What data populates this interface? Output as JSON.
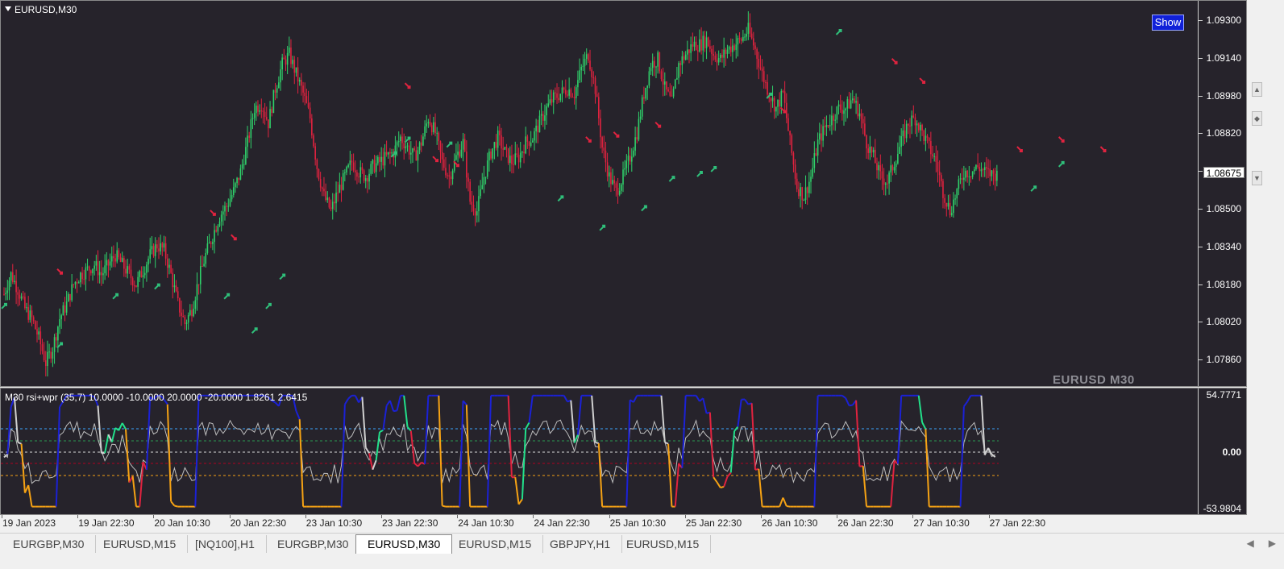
{
  "window": {
    "title": "EURUSD,M30"
  },
  "main_chart": {
    "symbol_title": "EURUSD,M30",
    "show_button": "Show",
    "watermark": "EURUSD M30",
    "current_price": "1.08675",
    "price_ticks": [
      "1.09300",
      "1.09140",
      "1.08980",
      "1.08820",
      "1.08660",
      "1.08500",
      "1.08340",
      "1.08180",
      "1.08020",
      "1.07860"
    ],
    "colors": {
      "background": "#26232b",
      "bull": "#2fd06a",
      "bear": "#e0233f",
      "buy_arrow": "#2fbf7a",
      "sell_arrow": "#e0233f"
    }
  },
  "indicator": {
    "title": "M30 rsi+wpr (35,7) 10.0000 -10.0000 20.0000 -20.0000 1.8261 2.6415",
    "ticks": [
      "54.7771",
      "0.00",
      "-53.9804"
    ],
    "colors": {
      "high": "#1b21d6",
      "upper": "#22e08a",
      "neutral": "#d0d0d0",
      "lower": "#e0233f",
      "low": "#f5a214"
    }
  },
  "time_axis": {
    "labels": [
      "19 Jan 2023",
      "19 Jan 22:30",
      "20 Jan 10:30",
      "20 Jan 22:30",
      "23 Jan 10:30",
      "23 Jan 22:30",
      "24 Jan 10:30",
      "24 Jan 22:30",
      "25 Jan 10:30",
      "25 Jan 22:30",
      "26 Jan 10:30",
      "26 Jan 22:30",
      "27 Jan 10:30",
      "27 Jan 22:30"
    ]
  },
  "tabs": [
    {
      "label": "EURGBP,M30",
      "active": false
    },
    {
      "label": "EURUSD,M15",
      "active": false
    },
    {
      "label": "[NQ100],H1",
      "active": false
    },
    {
      "label": "EURGBP,M30",
      "active": false
    },
    {
      "label": "EURUSD,M30",
      "active": true
    },
    {
      "label": "EURUSD,M15",
      "active": false
    },
    {
      "label": "GBPJPY,H1",
      "active": false
    },
    {
      "label": "EURUSD,M15",
      "active": false
    }
  ],
  "price_path": [
    [
      1.0818,
      1.0826,
      1.082,
      1.0812,
      1.0808,
      1.08,
      1.079,
      1.0796,
      1.0808,
      1.0814,
      1.0822,
      1.0826,
      1.0828,
      1.083,
      1.0826,
      1.083,
      1.0834,
      1.083,
      1.0826,
      1.0822,
      1.0828,
      1.0834,
      1.0838,
      1.0836,
      1.0826,
      1.0814,
      1.0806,
      1.0812,
      1.0824,
      1.0834,
      1.0842,
      1.085,
      1.0854,
      1.086,
      1.0868,
      1.088,
      1.0894,
      1.0896,
      1.0888,
      1.0902,
      1.0912,
      1.0916,
      1.0908,
      1.09,
      1.089,
      1.087,
      1.0858,
      1.0852,
      1.086,
      1.0866,
      1.0872,
      1.0868,
      1.0866,
      1.087,
      1.0872,
      1.0874,
      1.0876,
      1.0882,
      1.0878,
      1.0874,
      1.088,
      1.089,
      1.0884,
      1.0872,
      1.0866,
      1.0874,
      1.088,
      1.0856,
      1.0852,
      1.0866,
      1.0876,
      1.0882,
      1.0876,
      1.0872,
      1.0874,
      1.088,
      1.0882,
      1.0888,
      1.0894,
      1.0898,
      1.09,
      1.0902,
      1.09,
      1.091,
      1.0916,
      1.0902,
      1.0878,
      1.0866,
      1.086,
      1.0866,
      1.0874,
      1.0884,
      1.09,
      1.0912,
      1.0914,
      1.0902,
      1.0896,
      1.0912,
      1.0916,
      1.092,
      1.092,
      1.0922,
      1.0916,
      1.0914,
      1.0918,
      1.092,
      1.0922,
      1.0926,
      1.0918,
      1.0908,
      1.09,
      1.0894,
      1.09,
      1.088,
      1.0862,
      1.0858,
      1.0866,
      1.088,
      1.0886,
      1.089,
      1.0894,
      1.0894,
      1.0898,
      1.0892,
      1.088,
      1.0874,
      1.0866,
      1.0864,
      1.0872,
      1.088,
      1.0888,
      1.089,
      1.0884,
      1.0878,
      1.0872,
      1.086,
      1.0852,
      1.086,
      1.0868,
      1.0868,
      1.087,
      1.0868,
      1.0867
    ]
  ],
  "signals": {
    "buy": [
      [
        1.0818,
        0
      ],
      [
        1.0802,
        8
      ],
      [
        1.0822,
        16
      ],
      [
        1.0826,
        22
      ],
      [
        1.0822,
        32
      ],
      [
        1.0808,
        36
      ],
      [
        1.0818,
        38
      ],
      [
        1.083,
        40
      ],
      [
        1.088,
        56
      ],
      [
        1.0886,
        58
      ],
      [
        1.0884,
        64
      ],
      [
        1.0862,
        80
      ],
      [
        1.085,
        86
      ],
      [
        1.0858,
        92
      ],
      [
        1.087,
        96
      ],
      [
        1.0872,
        100
      ],
      [
        1.0874,
        102
      ],
      [
        1.0904,
        110
      ],
      [
        1.093,
        120
      ],
      [
        1.0866,
        148
      ],
      [
        1.0876,
        152
      ]
    ],
    "sell": [
      [
        1.0822,
        8
      ],
      [
        1.0846,
        30
      ],
      [
        1.0836,
        33
      ],
      [
        1.0898,
        58
      ],
      [
        1.0868,
        62
      ],
      [
        1.0866,
        65
      ],
      [
        1.0876,
        84
      ],
      [
        1.0878,
        88
      ],
      [
        1.0882,
        94
      ],
      [
        1.0888,
        112
      ],
      [
        1.0908,
        128
      ],
      [
        1.09,
        132
      ],
      [
        1.0872,
        146
      ],
      [
        1.0876,
        152
      ],
      [
        1.0872,
        158
      ]
    ]
  }
}
